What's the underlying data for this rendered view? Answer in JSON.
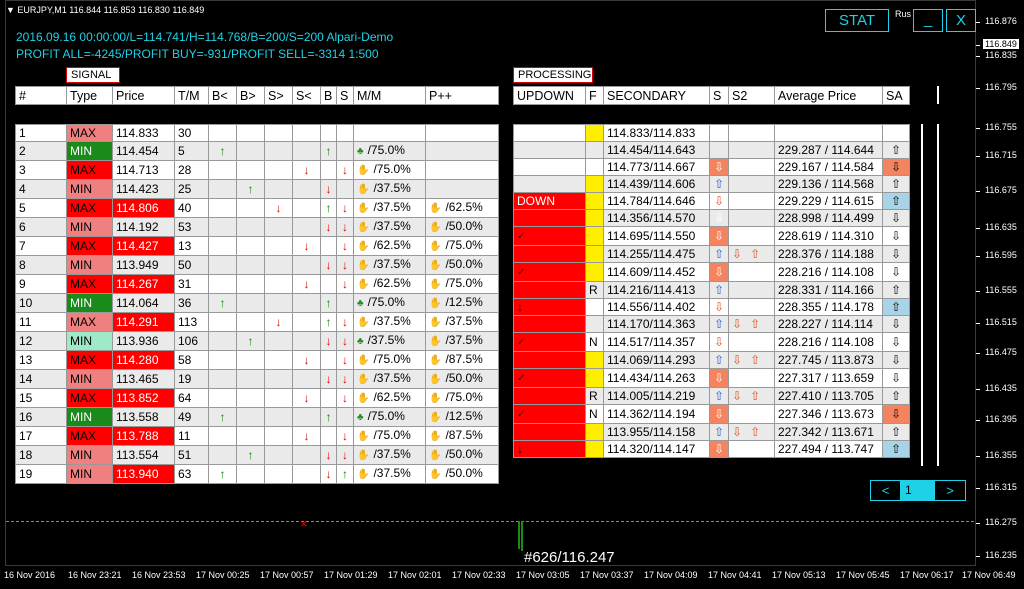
{
  "window": {
    "symbol_title": "EURJPY,M1  116.844 116.853 116.830 116.849",
    "lang": "Rus"
  },
  "info": {
    "line1": "2016.09.16 00:00:00/L=114.741/H=114.768/B=200/S=200   Alpari-Demo",
    "line2": "PROFIT ALL=-4245/PROFIT BUY=-931/PROFIT SELL=-3314     1:500"
  },
  "buttons": {
    "stat": "STAT",
    "minimize": "_",
    "close": "X",
    "prev": "<",
    "page": "1",
    "next": ">"
  },
  "signal": {
    "title": "SIGNAL",
    "headers": [
      "#",
      "Type",
      "Price",
      "T/M",
      "B<",
      "B>",
      "S>",
      "S<",
      "B",
      "S",
      "M/M",
      "P++"
    ]
  },
  "processing": {
    "title": "PROCESSING",
    "headers": [
      "UPDOWN",
      "F",
      "SECONDARY",
      "S",
      "S2",
      "Average Price",
      "SA"
    ]
  },
  "rows": [
    {
      "n": "1",
      "type": "MAX",
      "price": "114.833",
      "tm": "30",
      "mm": "",
      "pp": "",
      "updown": "",
      "f": "",
      "secondary": "114.833/114.833",
      "avg": "",
      "ud": "",
      "s": "",
      "s2a": "",
      "s2b": "",
      "sa": ""
    },
    {
      "n": "2",
      "type": "MIN",
      "price": "114.454",
      "tm": "5",
      "mm": "/75.0%",
      "pp": "",
      "updown": "",
      "f": "",
      "secondary": "114.454/114.643",
      "avg": "229.287 / 114.644",
      "ud": "",
      "s": "",
      "s2a": "",
      "s2b": "",
      "sa": "up"
    },
    {
      "n": "3",
      "type": "MAX",
      "price": "114.713",
      "tm": "28",
      "mm": "/75.0%",
      "pp": "",
      "updown": "",
      "f": "",
      "secondary": "114.773/114.667",
      "avg": "229.167 / 114.584",
      "ud": "",
      "s": "dnbox",
      "s2a": "",
      "s2b": "",
      "sa": "dn"
    },
    {
      "n": "4",
      "type": "MIN",
      "price": "114.423",
      "tm": "25",
      "mm": "/37.5%",
      "pp": "",
      "updown": "",
      "f": "",
      "secondary": "114.439/114.606",
      "avg": "229.136 / 114.568",
      "ud": "",
      "s": "up",
      "s2a": "",
      "s2b": "",
      "sa": "up"
    },
    {
      "n": "5",
      "type": "MAX",
      "price": "114.806",
      "tm": "40",
      "mm": "/37.5%",
      "pp": "/62.5%",
      "updown": "DOWN",
      "f": "",
      "secondary": "114.784/114.646",
      "avg": "229.229 / 114.615",
      "ud": "",
      "s": "dn",
      "s2a": "",
      "s2b": "",
      "sa": "up"
    },
    {
      "n": "6",
      "type": "MIN",
      "price": "114.192",
      "tm": "53",
      "mm": "/37.5%",
      "pp": "/50.0%",
      "updown": "",
      "f": "",
      "secondary": "114.356/114.570",
      "avg": "228.998 / 114.499",
      "ud": "",
      "s": "dnbox",
      "s2a": "",
      "s2b": "",
      "sa": "dn"
    },
    {
      "n": "7",
      "type": "MAX",
      "price": "114.427",
      "tm": "13",
      "mm": "/62.5%",
      "pp": "/75.0%",
      "updown": "",
      "f": "",
      "secondary": "114.695/114.550",
      "avg": "228.619 / 114.310",
      "ud": "check",
      "s": "dnbox",
      "s2a": "",
      "s2b": "",
      "sa": "dnw"
    },
    {
      "n": "8",
      "type": "MIN",
      "price": "113.949",
      "tm": "50",
      "mm": "/37.5%",
      "pp": "/50.0%",
      "updown": "",
      "f": "",
      "secondary": "114.255/114.475",
      "avg": "228.376 / 114.188",
      "ud": "",
      "s": "upbox",
      "s2a": "dn",
      "s2b": "dn",
      "sa": "dnw"
    },
    {
      "n": "9",
      "type": "MAX",
      "price": "114.267",
      "tm": "31",
      "mm": "/62.5%",
      "pp": "/75.0%",
      "updown": "",
      "f": "",
      "secondary": "114.609/114.452",
      "avg": "228.216 / 114.108",
      "ud": "check",
      "s": "dnbox",
      "s2a": "",
      "s2b": "",
      "sa": "dnw"
    },
    {
      "n": "10",
      "type": "MIN",
      "price": "114.064",
      "tm": "36",
      "mm": "/75.0%",
      "pp": "/12.5%",
      "updown": "",
      "f": "R",
      "secondary": "114.216/114.413",
      "avg": "228.331 / 114.166",
      "ud": "",
      "s": "up",
      "s2a": "",
      "s2b": "",
      "sa": "up"
    },
    {
      "n": "11",
      "type": "MAX",
      "price": "114.291",
      "tm": "113",
      "mm": "/37.5%",
      "pp": "/37.5%",
      "updown": "",
      "f": "",
      "secondary": "114.556/114.402",
      "avg": "228.355 / 114.178",
      "ud": "down",
      "s": "dn",
      "s2a": "",
      "s2b": "",
      "sa": "up"
    },
    {
      "n": "12",
      "type": "MIN",
      "price": "113.936",
      "tm": "106",
      "mm": "/37.5%",
      "pp": "/37.5%",
      "updown": "",
      "f": "",
      "secondary": "114.170/114.363",
      "avg": "228.227 / 114.114",
      "ud": "",
      "s": "up",
      "s2a": "dn",
      "s2b": "dn",
      "sa": "dn"
    },
    {
      "n": "13",
      "type": "MAX",
      "price": "114.280",
      "tm": "58",
      "mm": "/75.0%",
      "pp": "/87.5%",
      "updown": "",
      "f": "N",
      "secondary": "114.517/114.357",
      "avg": "228.216 / 114.108",
      "ud": "check",
      "s": "dn",
      "s2a": "",
      "s2b": "",
      "sa": "dnw"
    },
    {
      "n": "14",
      "type": "MIN",
      "price": "113.465",
      "tm": "19",
      "mm": "/37.5%",
      "pp": "/50.0%",
      "updown": "",
      "f": "",
      "secondary": "114.069/114.293",
      "avg": "227.745 / 113.873",
      "ud": "",
      "s": "upbox",
      "s2a": "dn",
      "s2b": "dn",
      "sa": "dnw"
    },
    {
      "n": "15",
      "type": "MAX",
      "price": "113.852",
      "tm": "64",
      "mm": "/62.5%",
      "pp": "/75.0%",
      "updown": "",
      "f": "",
      "secondary": "114.434/114.263",
      "avg": "227.317 / 113.659",
      "ud": "check",
      "s": "dnbox",
      "s2a": "",
      "s2b": "",
      "sa": "dnw"
    },
    {
      "n": "16",
      "type": "MIN",
      "price": "113.558",
      "tm": "49",
      "mm": "/75.0%",
      "pp": "/12.5%",
      "updown": "",
      "f": "R",
      "secondary": "114.005/114.219",
      "avg": "227.410 / 113.705",
      "ud": "",
      "s": "up",
      "s2a": "dn",
      "s2b": "dn",
      "sa": "up"
    },
    {
      "n": "17",
      "type": "MAX",
      "price": "113.788",
      "tm": "11",
      "mm": "/75.0%",
      "pp": "/87.5%",
      "updown": "",
      "f": "N",
      "secondary": "114.362/114.194",
      "avg": "227.346 / 113.673",
      "ud": "check",
      "s": "dnbox",
      "s2a": "",
      "s2b": "",
      "sa": "dn"
    },
    {
      "n": "18",
      "type": "MIN",
      "price": "113.554",
      "tm": "51",
      "mm": "/37.5%",
      "pp": "/50.0%",
      "updown": "",
      "f": "",
      "secondary": "113.955/114.158",
      "avg": "227.342 / 113.671",
      "ud": "",
      "s": "up",
      "s2a": "dn",
      "s2b": "dn",
      "sa": "up"
    },
    {
      "n": "19",
      "type": "MIN",
      "price": "113.940",
      "tm": "63",
      "mm": "/37.5%",
      "pp": "/50.0%",
      "updown": "",
      "f": "",
      "secondary": "114.320/114.147",
      "avg": "227.494 / 113.747",
      "ud": "down",
      "s": "dnbox",
      "s2a": "",
      "s2b": "",
      "sa": "up"
    }
  ],
  "price_axis": [
    "116.876",
    "116.849",
    "116.835",
    "116.795",
    "116.755",
    "116.715",
    "116.675",
    "116.635",
    "116.595",
    "116.555",
    "116.515",
    "116.475",
    "116.435",
    "116.395",
    "116.355",
    "116.315",
    "116.275",
    "116.235"
  ],
  "time_axis": [
    "16 Nov 2016",
    "16 Nov 23:21",
    "16 Nov 23:53",
    "17 Nov 00:25",
    "17 Nov 00:57",
    "17 Nov 01:29",
    "17 Nov 02:01",
    "17 Nov 02:33",
    "17 Nov 03:05",
    "17 Nov 03:37",
    "17 Nov 04:09",
    "17 Nov 04:41",
    "17 Nov 05:13",
    "17 Nov 05:45",
    "17 Nov 06:17",
    "17 Nov 06:49"
  ],
  "chart_label": "#626/116.247",
  "colors": {
    "info_cyan": "#1fd1e6",
    "max_red": "#ff0000",
    "max_pink": "#f08080",
    "min_green": "#1a8a1a",
    "min_mint": "#9fe8c8",
    "updown_red": "#ff0000",
    "f_yellow": "#ffee00",
    "sa_up": "#a9d4e8",
    "sa_dn": "#f4845f"
  }
}
